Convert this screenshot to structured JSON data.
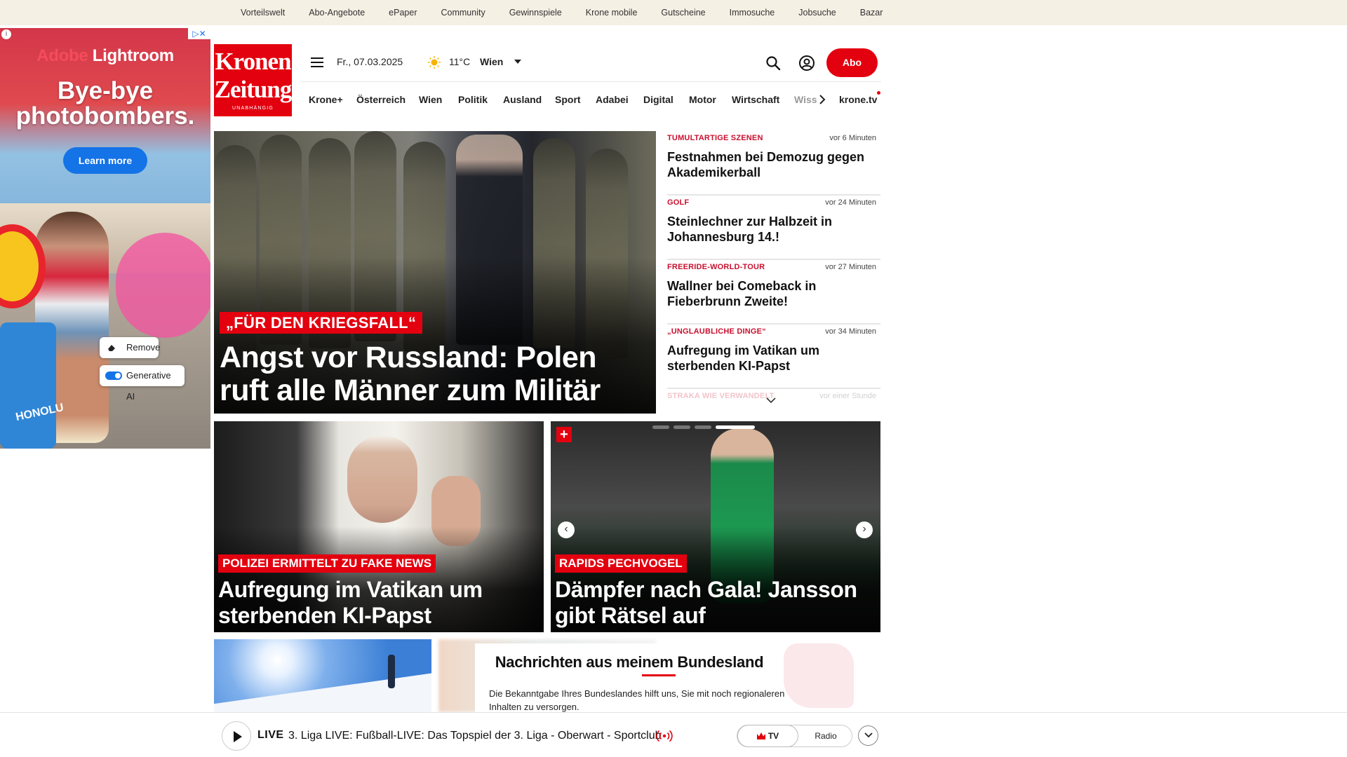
{
  "topbar": {
    "links": [
      "Vorteilswelt",
      "Abo-Angebote",
      "ePaper",
      "Community",
      "Gewinnspiele",
      "Krone mobile",
      "Gutscheine",
      "Immosuche",
      "Jobsuche",
      "Bazar"
    ]
  },
  "ad": {
    "brand_a": "Adobe",
    "brand_b": "Lightroom",
    "headline": "Bye-bye photobombers.",
    "cta": "Learn more",
    "remove_label": "Remove",
    "genai_label": "Generative AI",
    "can_text": "HONOLU",
    "choices": "▷✕",
    "info": "i"
  },
  "logo": {
    "line1": "Kronen",
    "line2": "Zeitung",
    "tagline": "UNABHÄNGIG"
  },
  "header": {
    "date": "Fr., 07.03.2025",
    "weather_icon": "sun-icon",
    "temperature": "11°C",
    "city": "Wien",
    "abo_label": "Abo"
  },
  "nav": {
    "items": [
      "Krone+",
      "Österreich",
      "Wien",
      "Politik",
      "Ausland",
      "Sport",
      "Adabei",
      "Digital",
      "Motor",
      "Wirtschaft"
    ],
    "overflow": "Wiss",
    "tv_label": "krone.tv"
  },
  "hero": {
    "kicker": "„FÜR DEN KRIEGSFALL“",
    "title": "Angst vor Russland: Polen ruft alle Männer zum Militär"
  },
  "ticker": [
    {
      "category": "TUMULTARTIGE SZENEN",
      "time": "vor 6 Minuten",
      "title": "Festnahmen bei Demozug gegen Akademikerball"
    },
    {
      "category": "GOLF",
      "time": "vor 24 Minuten",
      "title": "Steinlechner zur Halbzeit in Johannesburg 14.!"
    },
    {
      "category": "FREERIDE-WORLD-TOUR",
      "time": "vor 27 Minuten",
      "title": "Wallner bei Comeback in Fieberbrunn Zweite!"
    },
    {
      "category": "„UNGLAUBLICHE DINGE“",
      "time": "vor 34 Minuten",
      "title": "Aufregung im Vatikan um sterbenden KI-Papst"
    },
    {
      "category": "STRAKA WIE VERWANDELT",
      "time": "vor einer Stunde",
      "title": ""
    }
  ],
  "teasers": [
    {
      "kicker": "POLIZEI ERMITTELT ZU FAKE NEWS",
      "title": "Aufregung im Vatikan um sterbenden KI-Papst"
    },
    {
      "kicker": "RAPIDS PECHVOGEL",
      "title": "Dämpfer nach Gala! Jansson gibt Rätsel auf",
      "plus_badge": "+",
      "prev": "‹",
      "next": "›"
    }
  ],
  "bundesland": {
    "title": "Nachrichten aus meinem Bundesland",
    "text": "Die Bekanntgabe Ihres Bundeslandes hilft uns, Sie mit noch regionaleren Inhalten zu versorgen."
  },
  "livebar": {
    "live_label": "LIVE",
    "text": "3. Liga LIVE: Fußball-LIVE: Das Topspiel der 3. Liga - Oberwart - Sportclub",
    "tv_label": "TV",
    "radio_label": "Radio"
  },
  "colors": {
    "brand_red": "#e3000f",
    "topbar_bg": "#f5f0e4",
    "ticker_category": "#c8102e"
  }
}
